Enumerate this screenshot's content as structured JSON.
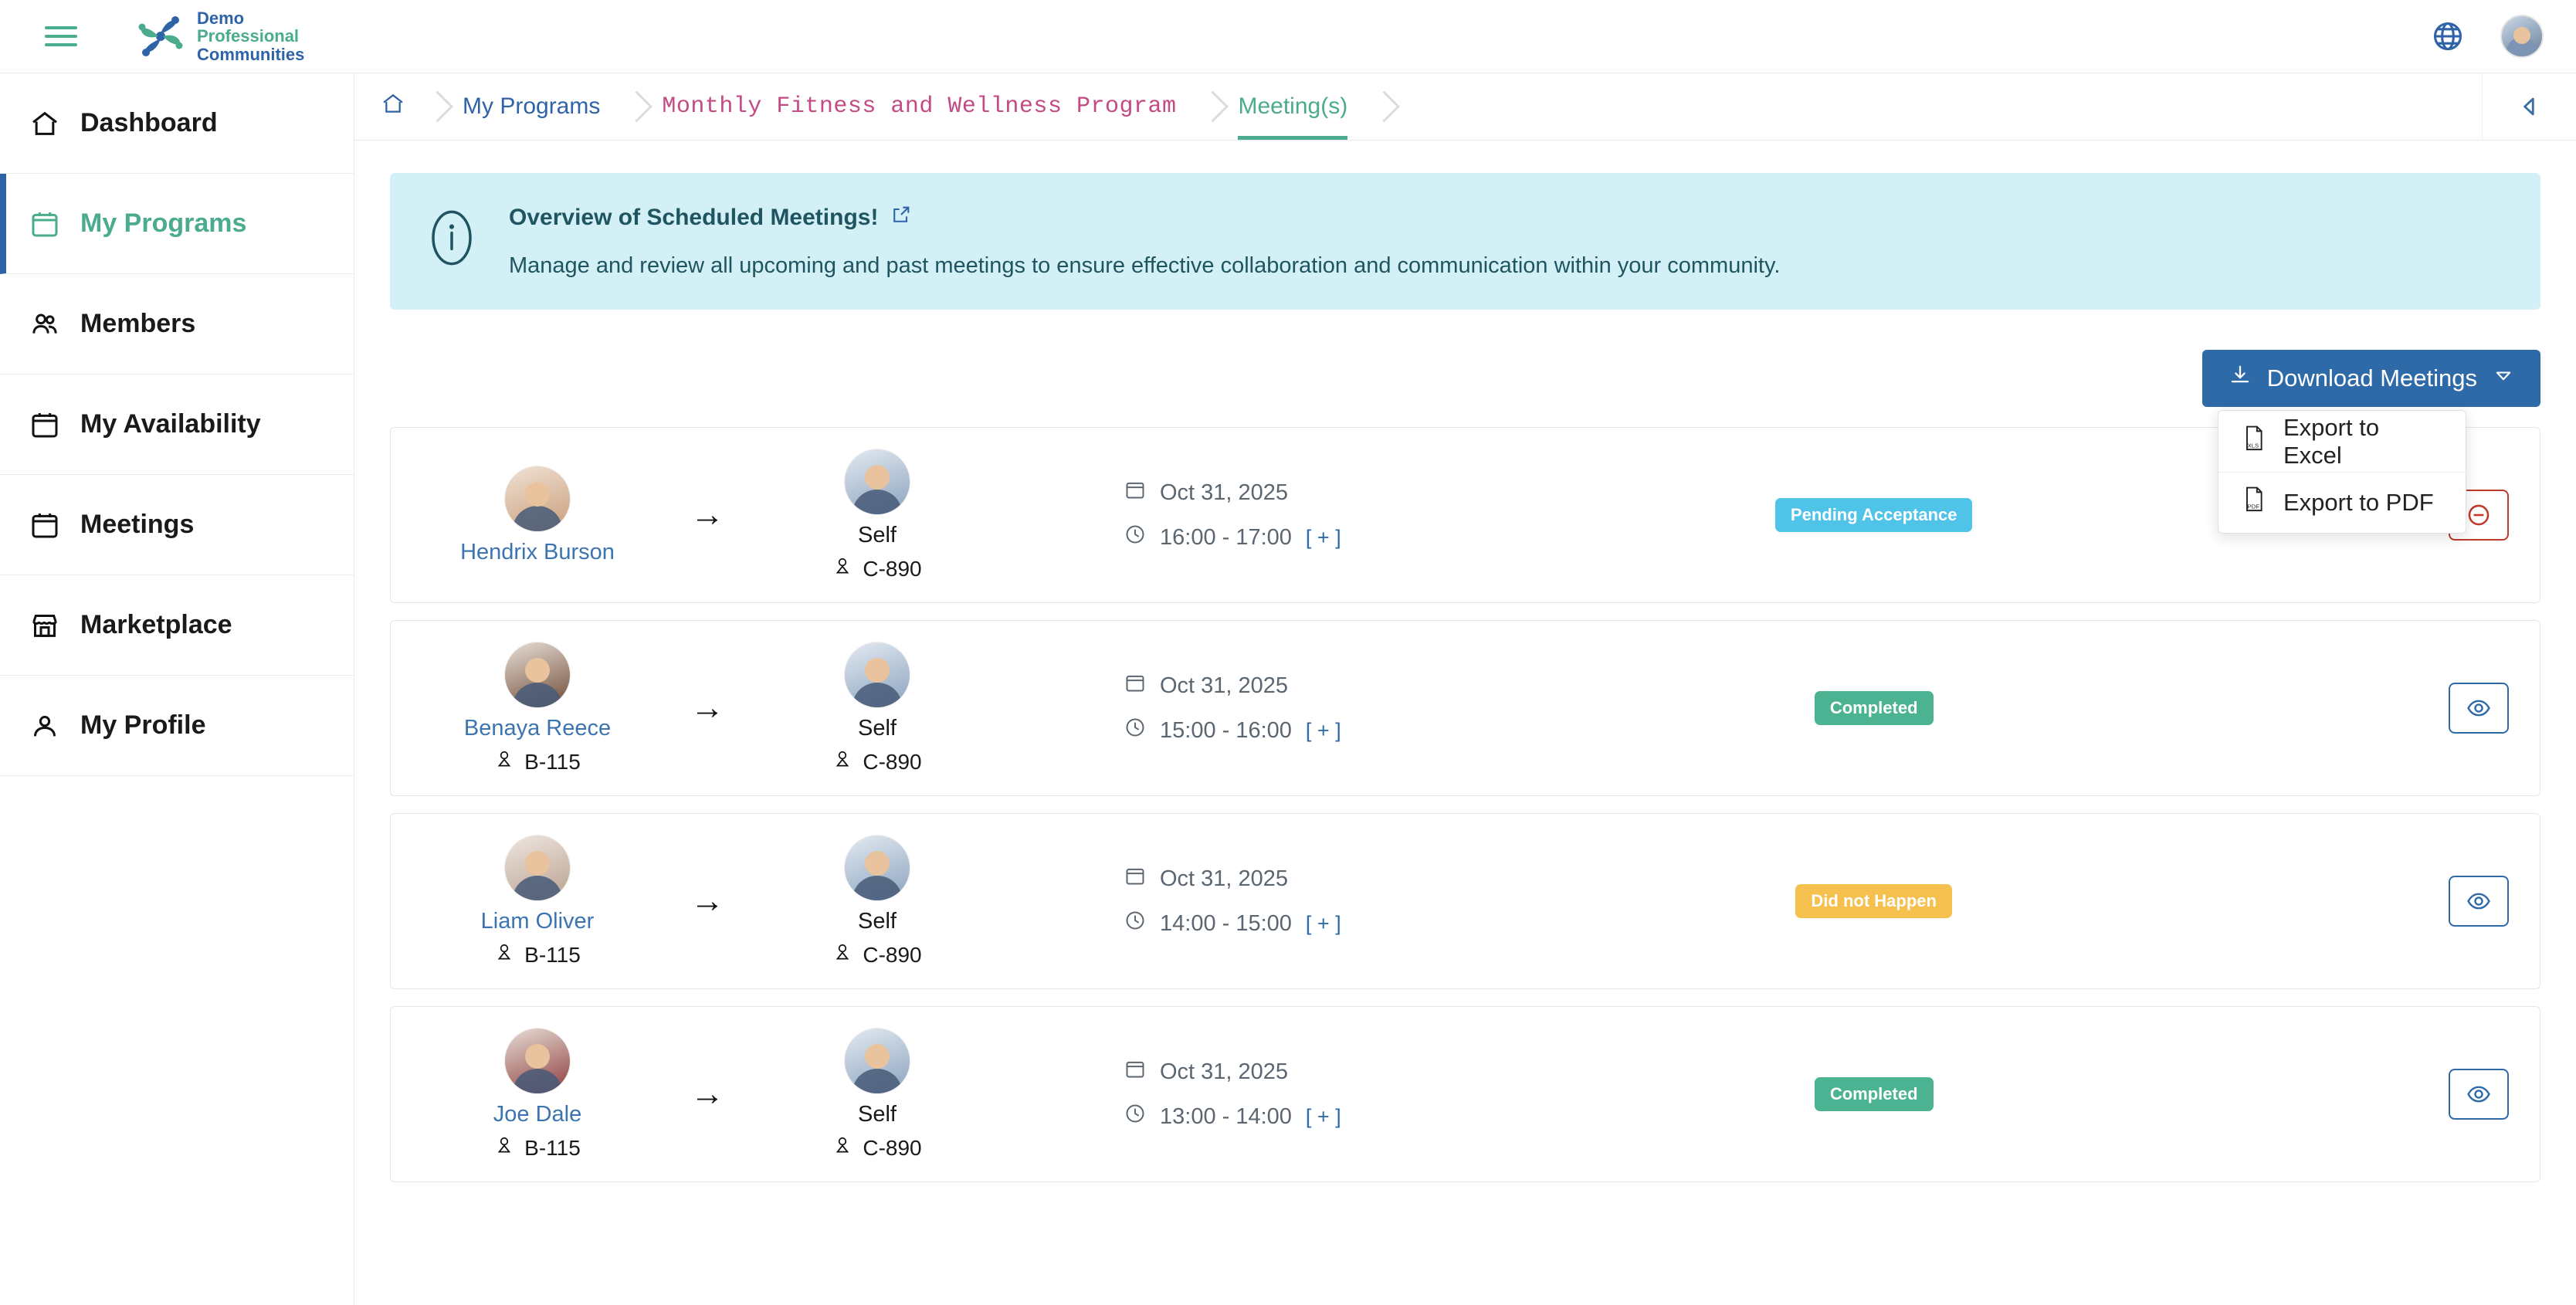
{
  "brand": {
    "line1": "Demo",
    "line2": "Professional",
    "line3": "Communities"
  },
  "topbar": {
    "menu_icon": "hamburger-icon",
    "language_icon": "globe-icon",
    "avatar": "user-avatar"
  },
  "sidebar": {
    "items": [
      {
        "label": "Dashboard",
        "icon": "home-icon",
        "active": false
      },
      {
        "label": "My Programs",
        "icon": "calendar-icon",
        "active": true
      },
      {
        "label": "Members",
        "icon": "users-icon",
        "active": false
      },
      {
        "label": "My Availability",
        "icon": "calendar-icon",
        "active": false
      },
      {
        "label": "Meetings",
        "icon": "calendar-icon",
        "active": false
      },
      {
        "label": "Marketplace",
        "icon": "storefront-icon",
        "active": false
      },
      {
        "label": "My Profile",
        "icon": "user-circle-icon",
        "active": false
      }
    ]
  },
  "breadcrumb": {
    "home_icon": "home-icon",
    "items": [
      {
        "label": "My Programs",
        "style": "link"
      },
      {
        "label": "Monthly Fitness and Wellness Program",
        "style": "title"
      },
      {
        "label": "Meeting(s)",
        "style": "active"
      }
    ],
    "collapse_icon": "caret-left-icon"
  },
  "banner": {
    "icon": "info-circle-icon",
    "title": "Overview of Scheduled Meetings!",
    "external_icon": "external-link-icon",
    "description": "Manage and review all upcoming and past meetings to ensure effective collaboration and communication within your community."
  },
  "download": {
    "label": "Download Meetings",
    "icon": "download-icon",
    "caret": "caret-down-icon",
    "open": true,
    "options": [
      {
        "label": "Export to Excel",
        "icon": "file-xls-icon"
      },
      {
        "label": "Export to PDF",
        "icon": "file-pdf-icon"
      }
    ]
  },
  "colors": {
    "primary_blue": "#2f6aa8",
    "teal": "#4aab8e",
    "pink": "#c44a85",
    "banner_bg": "#d4f0f7",
    "status_pending": "#4fc3e8",
    "status_completed": "#4bb391",
    "status_missed": "#f5c04e",
    "danger": "#c0392b"
  },
  "meetings": [
    {
      "from_name": "Hendrix Burson",
      "from_id": "",
      "to_name": "Self",
      "to_id": "C-890",
      "date": "Oct 31, 2025",
      "time": "16:00 - 17:00",
      "expand": "[ + ]",
      "status": "Pending Acceptance",
      "status_color": "#4fc3e8",
      "action": "cancel-meeting-button",
      "action_icon": "circle-minus-icon"
    },
    {
      "from_name": "Benaya Reece",
      "from_id": "B-115",
      "to_name": "Self",
      "to_id": "C-890",
      "date": "Oct 31, 2025",
      "time": "15:00 - 16:00",
      "expand": "[ + ]",
      "status": "Completed",
      "status_color": "#4bb391",
      "action": "view-meeting-button",
      "action_icon": "eye-icon"
    },
    {
      "from_name": "Liam Oliver",
      "from_id": "B-115",
      "to_name": "Self",
      "to_id": "C-890",
      "date": "Oct 31, 2025",
      "time": "14:00 - 15:00",
      "expand": "[ + ]",
      "status": "Did not Happen",
      "status_color": "#f5c04e",
      "action": "view-meeting-button",
      "action_icon": "eye-icon"
    },
    {
      "from_name": "Joe Dale",
      "from_id": "B-115",
      "to_name": "Self",
      "to_id": "C-890",
      "date": "Oct 31, 2025",
      "time": "13:00 - 14:00",
      "expand": "[ + ]",
      "status": "Completed",
      "status_color": "#4bb391",
      "action": "view-meeting-button",
      "action_icon": "eye-icon"
    }
  ]
}
